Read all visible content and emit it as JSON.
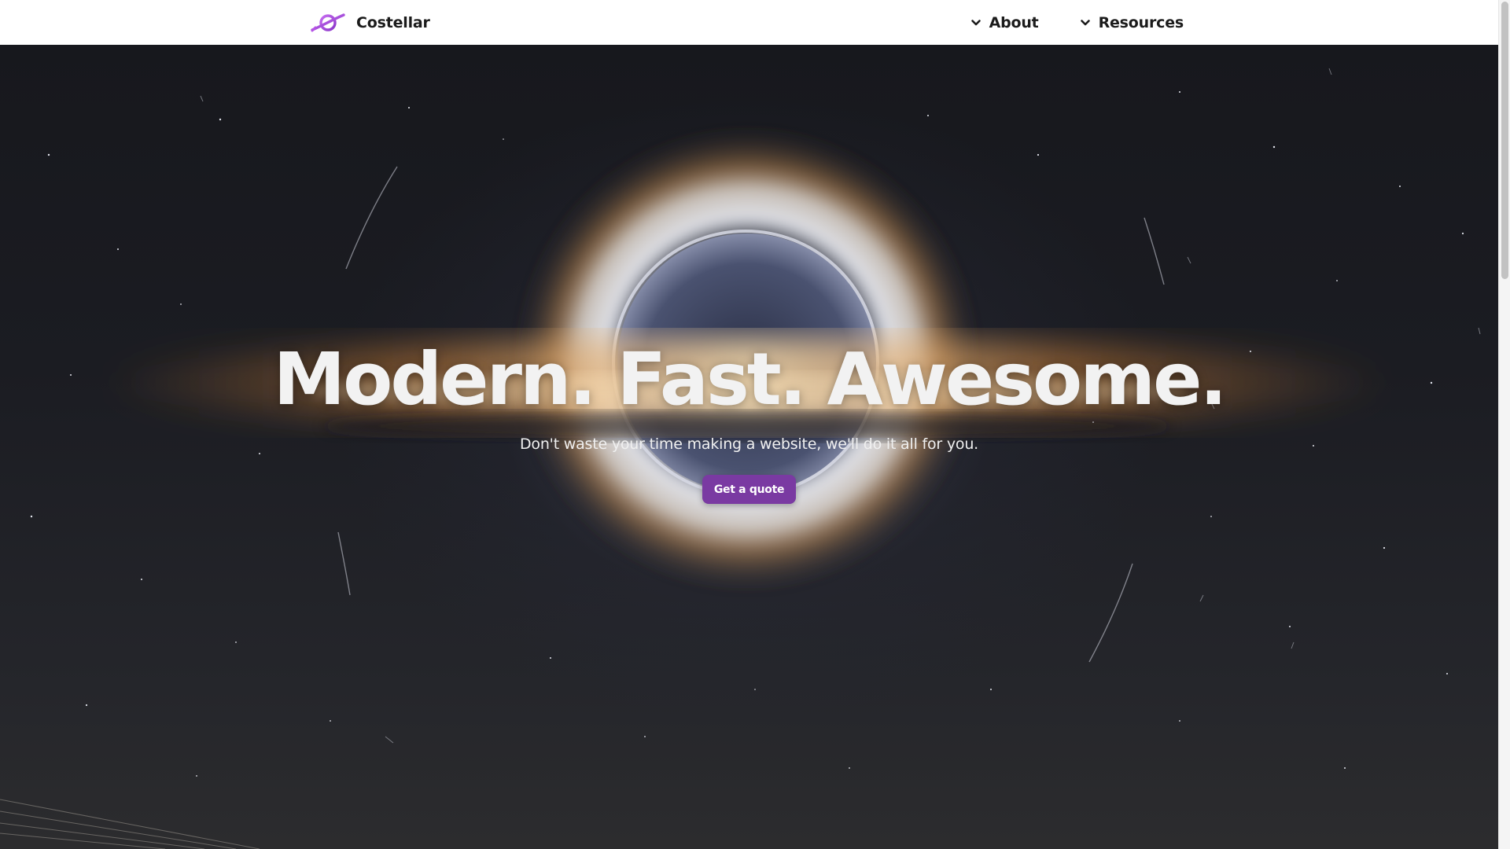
{
  "navbar": {
    "brand_name": "Costellar",
    "logo_icon": "planet-logo-icon",
    "brand_color": "#a24ed6",
    "nav_items": [
      {
        "label": "About",
        "icon": "chevron-down-icon"
      },
      {
        "label": "Resources",
        "icon": "chevron-down-icon"
      }
    ]
  },
  "hero": {
    "headline": "Modern. Fast. Awesome.",
    "subtitle": "Don't waste your time making a website, we'll do it all for you.",
    "cta_label": "Get a quote",
    "cta_color": "#7a3aa2",
    "background": "black-hole-space-image"
  }
}
